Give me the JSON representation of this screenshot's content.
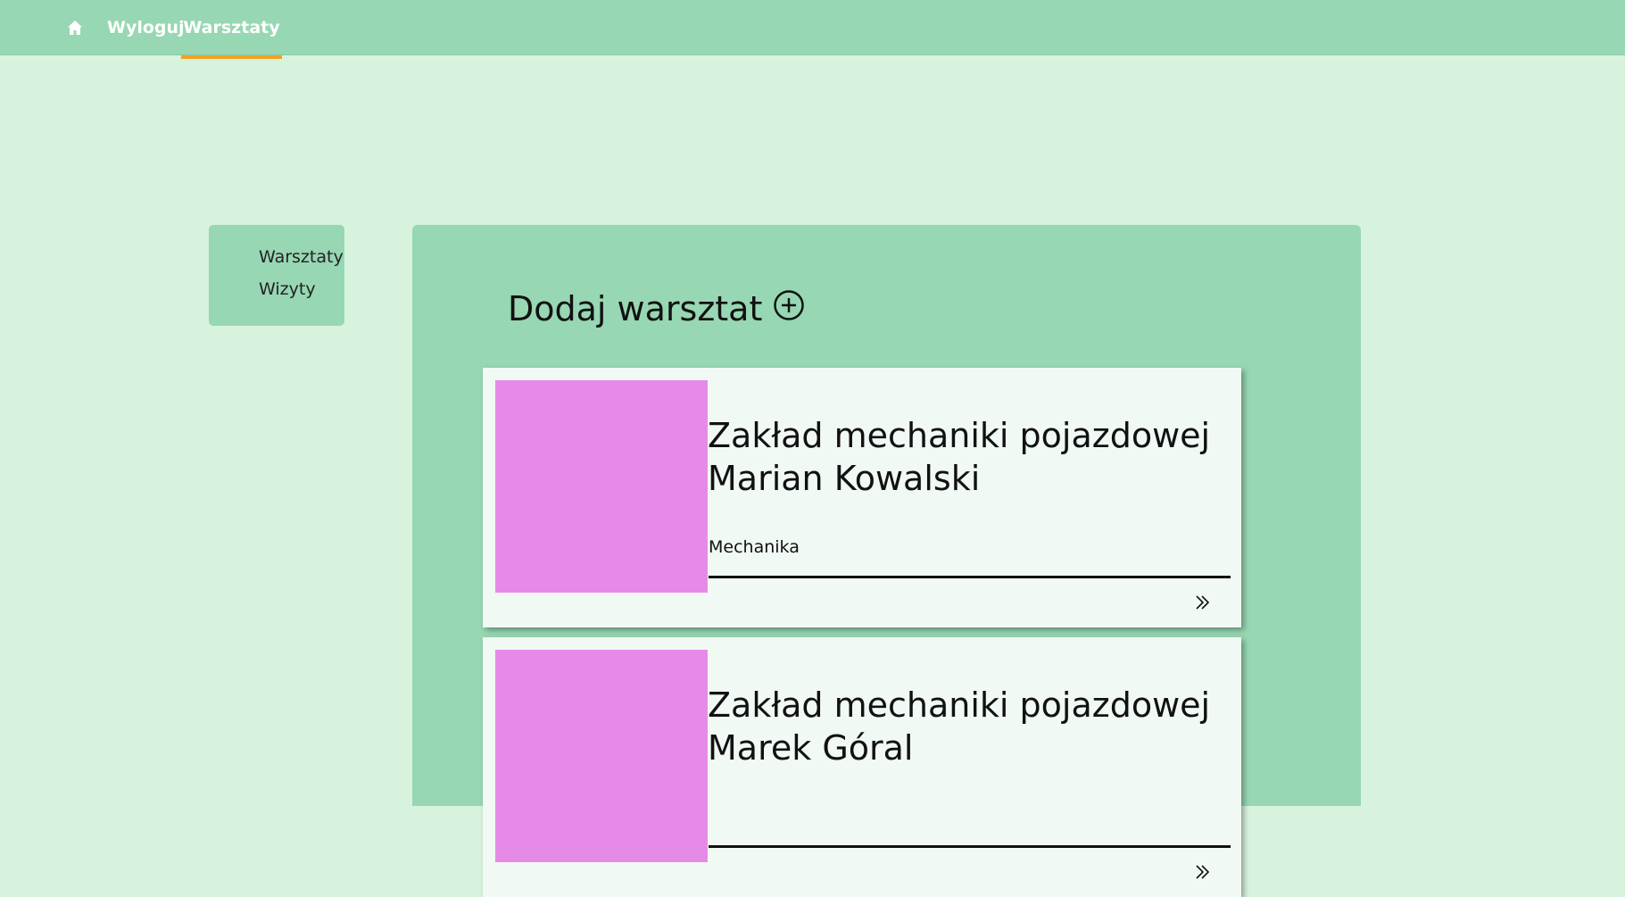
{
  "nav": {
    "home_icon": "home-icon",
    "logout_label": "Wyloguj",
    "workshops_label": "Warsztaty",
    "active_accent": "#f3a21f"
  },
  "sidebar": {
    "items": [
      {
        "label": "Warsztaty"
      },
      {
        "label": "Wizyty"
      }
    ]
  },
  "main": {
    "add_title": "Dodaj warsztat",
    "add_icon": "plus-circle-icon",
    "workshops": [
      {
        "title": "Zakład mechaniki pojazdowej Marian Kowalski",
        "category": "Mechanika",
        "details_icon": "double-chevron-right-icon"
      },
      {
        "title": "Zakład mechaniki pojazdowej Marek Góral",
        "category": "",
        "details_icon": "double-chevron-right-icon"
      }
    ]
  },
  "colors": {
    "background": "#d8f3dd",
    "nav_bg": "#97d7b3",
    "panel_bg": "#97d7b3",
    "card_bg": "#f1f9f4",
    "thumbnail": "#e68ae8"
  }
}
